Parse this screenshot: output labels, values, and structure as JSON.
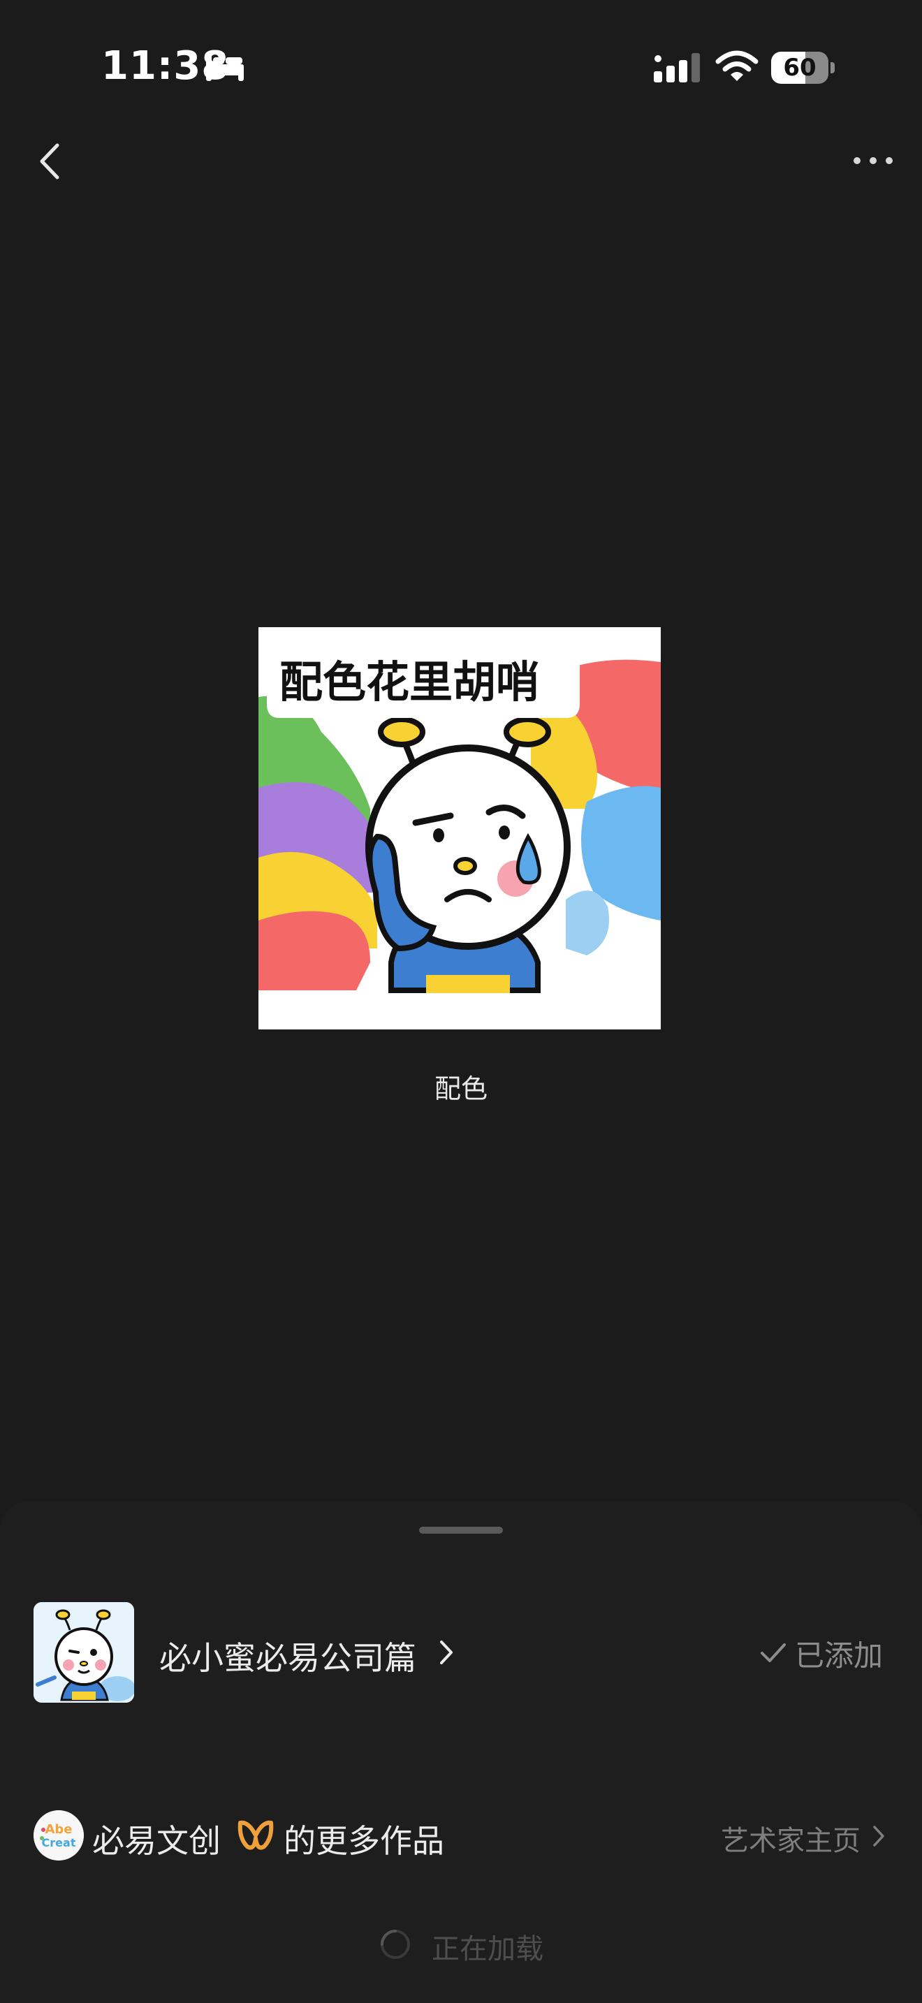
{
  "status_bar": {
    "time": "11:38",
    "battery": "60",
    "battery_level": 0.6
  },
  "sticker": {
    "overlay_text": "配色花里胡哨",
    "caption": "配色"
  },
  "pack": {
    "title": "必小蜜必易公司篇",
    "status": "已添加"
  },
  "artist": {
    "avatar_text": "Abe Creat",
    "name": "必易文创",
    "more_works": "的更多作品",
    "home_link": "艺术家主页"
  },
  "loading": {
    "text": "正在加载"
  },
  "icons": {
    "back": "chevron-left-icon",
    "more": "ellipsis-icon",
    "check": "checkmark-icon",
    "spinner": "loading-spinner-icon"
  },
  "colors": {
    "background": "#1b1b1b",
    "sheet": "#1e1e1e",
    "badge": "#f0a03a"
  }
}
